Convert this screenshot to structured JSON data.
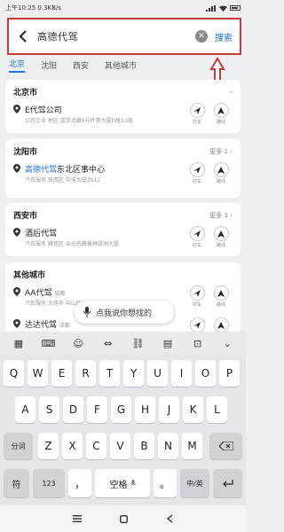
{
  "status": {
    "left_text": "上午10:25 0.3KB/s"
  },
  "search": {
    "query": "高德代驾",
    "button": "搜索"
  },
  "tabs": [
    "北京",
    "沈阳",
    "西安",
    "其他城市"
  ],
  "cards": [
    {
      "title": "北京市",
      "more": "",
      "items": [
        {
          "name": "E代驾公司",
          "hl": "",
          "sub": "公司企业 地区 望京北路9号叶青大厦D座13层",
          "a1": "打车",
          "a2": "路线"
        }
      ]
    },
    {
      "title": "沈阳市",
      "more": "更多 1 ›",
      "items": [
        {
          "name": "东北区事中心",
          "hl": "高德代驾",
          "sub": "汽车服务 铁西区 中城大厦2012",
          "a1": "打车",
          "a2": "路线"
        }
      ]
    },
    {
      "title": "西安市",
      "more": "更多 3 ›",
      "items": [
        {
          "name": "酒后代驾",
          "hl": "",
          "sub": "汽车服务 雁塔区 含光南路枫林绿洲大厦",
          "a1": "打车",
          "a2": "路线"
        }
      ]
    },
    {
      "title": "其他城市",
      "more": "",
      "items": [
        {
          "name": "AA代驾",
          "hl": "",
          "sub": "汽车服务 大连市 中山区",
          "a1": "打车",
          "a2": "路线",
          "city": "成都"
        },
        {
          "name": "达达代驾",
          "hl": "",
          "sub": "",
          "a1": "打车",
          "a2": "路线",
          "city": "成都"
        }
      ]
    }
  ],
  "voice": {
    "label": "点我说你想找的"
  },
  "keyboard": {
    "row1": [
      "Q",
      "W",
      "E",
      "R",
      "T",
      "Y",
      "U",
      "I",
      "O",
      "P"
    ],
    "row2": [
      "A",
      "S",
      "D",
      "F",
      "G",
      "H",
      "J",
      "K",
      "L"
    ],
    "row3": [
      "Z",
      "X",
      "C",
      "V",
      "B",
      "N",
      "M"
    ],
    "fenci": "分词",
    "sym": "符",
    "num": "123",
    "comma": "，",
    "space": "空格",
    "period": "。",
    "lang": "中/英"
  }
}
